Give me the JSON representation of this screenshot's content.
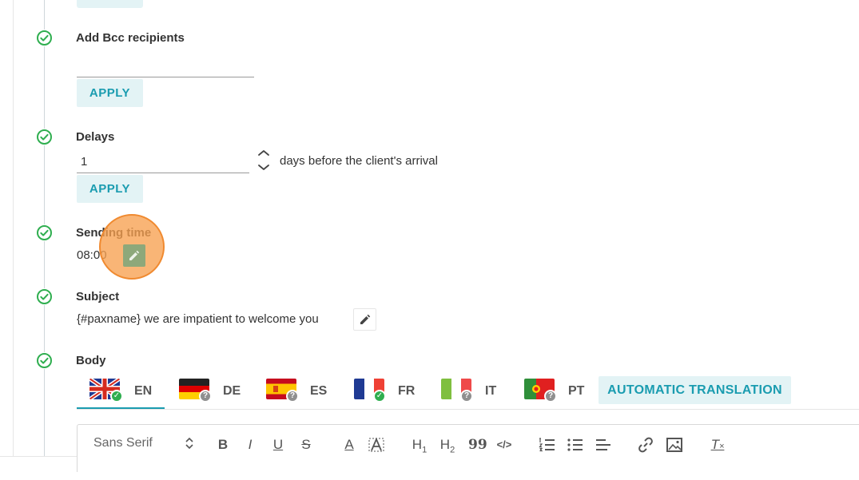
{
  "settings": {
    "bcc": {
      "label": "Add Bcc recipients",
      "value": "",
      "apply_label": "APPLY"
    },
    "delays": {
      "label": "Delays",
      "value": "1",
      "suffix": "days before the client's arrival",
      "apply_label": "APPLY"
    },
    "sending_time": {
      "label": "Sending time",
      "value": "08:00"
    },
    "subject": {
      "label": "Subject",
      "value": "{#paxname} we are impatient to welcome you"
    },
    "body": {
      "label": "Body"
    }
  },
  "languages": [
    {
      "code": "EN",
      "status": "done",
      "active": true
    },
    {
      "code": "DE",
      "status": "missing",
      "active": false
    },
    {
      "code": "ES",
      "status": "missing",
      "active": false
    },
    {
      "code": "FR",
      "status": "done",
      "active": false
    },
    {
      "code": "IT",
      "status": "missing",
      "active": false
    },
    {
      "code": "PT",
      "status": "missing",
      "active": false
    }
  ],
  "auto_translation_label": "AUTOMATIC TRANSLATION",
  "toolbar": {
    "font_family": "Sans Serif",
    "tools": [
      "bold-icon",
      "italic-icon",
      "underline-icon",
      "strike-icon",
      "text-color-icon",
      "background-color-icon",
      "heading1-icon",
      "heading2-icon",
      "blockquote-icon",
      "code-block-icon",
      "ordered-list-icon",
      "bullet-list-icon",
      "align-icon",
      "link-icon",
      "image-icon",
      "clear-format-icon"
    ],
    "labels": {
      "bold": "B",
      "italic": "I",
      "underline": "U",
      "strike": "S",
      "text_color": "A",
      "h1": "H",
      "h1_sub": "1",
      "h2": "H",
      "h2_sub": "2",
      "quote": "99",
      "code": "</>",
      "clear": "T"
    }
  },
  "colors": {
    "accent": "#1a9cb0",
    "accent_bg": "#e3f3f5",
    "check_green": "#2fae4f",
    "highlight_orange": "#f7a050"
  }
}
